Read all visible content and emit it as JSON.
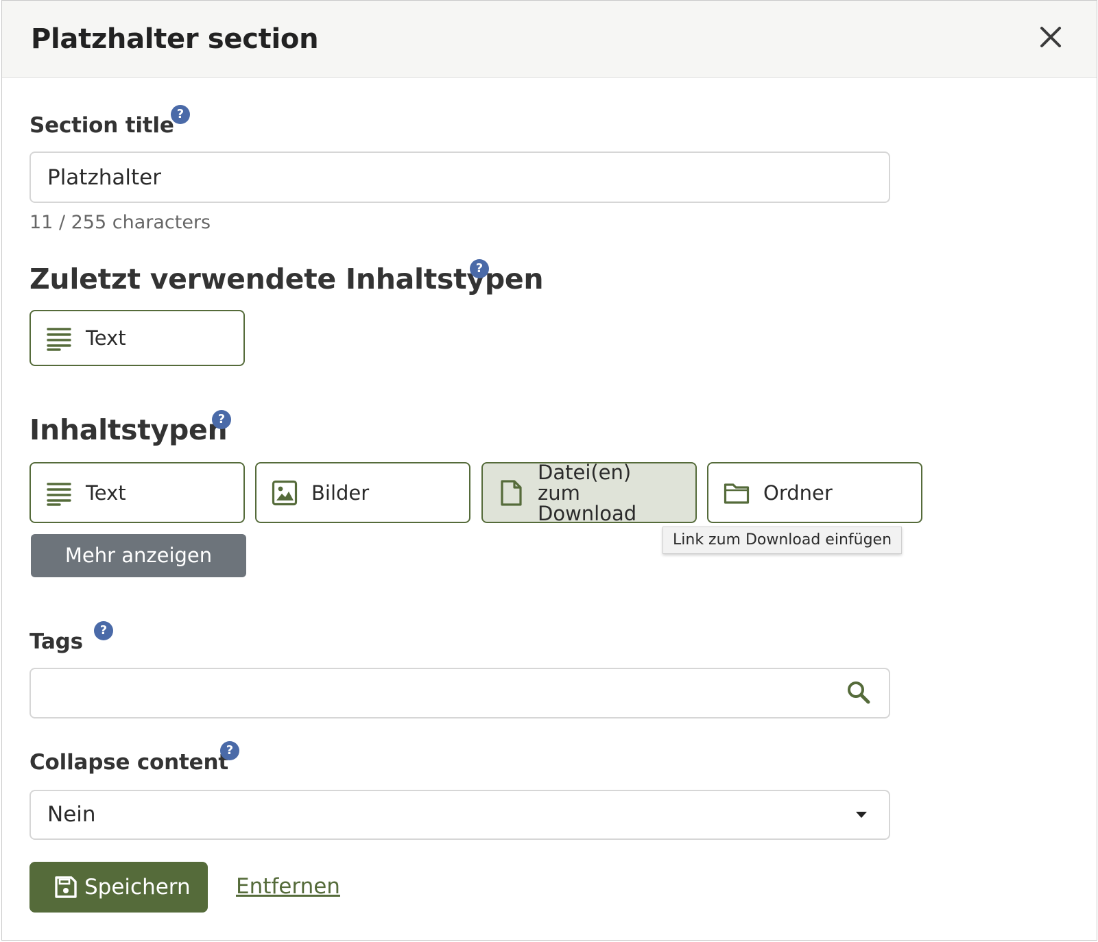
{
  "modal": {
    "title": "Platzhalter section",
    "close_icon": "close-icon"
  },
  "section_title": {
    "label": "Section title",
    "value": "Platzhalter",
    "char_count": "11 / 255 characters",
    "help": "?"
  },
  "recent_types": {
    "heading": "Zuletzt verwendete Inhaltstypen",
    "help": "?",
    "items": [
      {
        "label": "Text",
        "icon": "text-lines-icon"
      }
    ]
  },
  "content_types": {
    "heading": "Inhaltstypen",
    "help": "?",
    "items": [
      {
        "label": "Text",
        "icon": "text-lines-icon"
      },
      {
        "label": "Bilder",
        "icon": "image-icon"
      },
      {
        "label": "Datei(en) zum Download",
        "icon": "file-icon",
        "active": true
      },
      {
        "label": "Ordner",
        "icon": "folder-icon"
      }
    ],
    "more_label": "Mehr anzeigen",
    "tooltip": "Link zum Download einfügen"
  },
  "tags": {
    "label": "Tags",
    "help": "?",
    "value": "",
    "icon": "search-icon"
  },
  "collapse": {
    "label": "Collapse content",
    "help": "?",
    "selected": "Nein"
  },
  "actions": {
    "save_label": "Speichern",
    "save_icon": "save-icon",
    "remove_label": "Entfernen"
  },
  "colors": {
    "accent": "#556b3a",
    "help_badge": "#4a6aa8",
    "secondary_button": "#6d747b"
  }
}
